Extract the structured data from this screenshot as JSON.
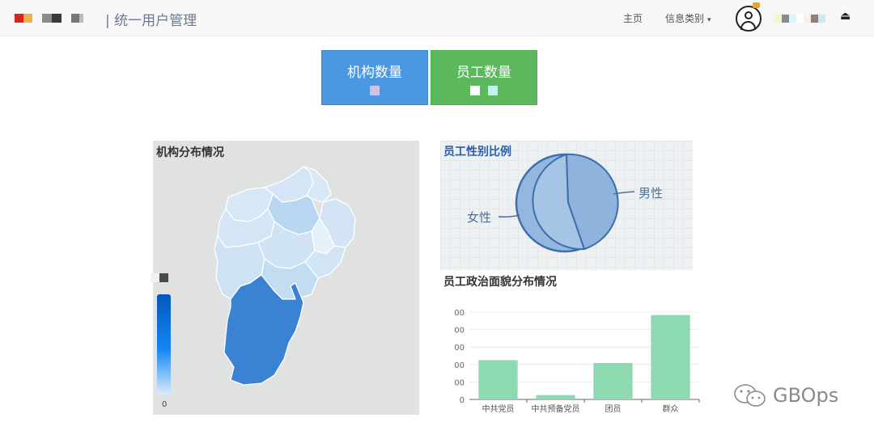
{
  "header": {
    "brand": "| 统一用户管理",
    "nav_home": "主页",
    "nav_info": "信息类别",
    "caret": "▾",
    "logout_icon": "⏏"
  },
  "cards": {
    "org_title": "机构数量",
    "emp_title": "员工数量"
  },
  "map": {
    "title": "机构分布情况",
    "legend_min": "0"
  },
  "gender": {
    "title": "员工性别比例",
    "male_label": "男性",
    "female_label": "女性"
  },
  "politics": {
    "title": "员工政治面貌分布情况"
  },
  "chart_data": {
    "type": "bar",
    "categories": [
      "中共党员",
      "中共预备党员",
      "团员",
      "群众"
    ],
    "values": [
      27,
      3,
      25,
      58
    ],
    "ylim": [
      0,
      60
    ],
    "yticks": [
      "00",
      "00",
      "00",
      "00",
      "00",
      "0"
    ],
    "bar_color": "#8dd9b0"
  },
  "watermark": {
    "text": "GBOps",
    "icon": "wechat-icon"
  },
  "colors": {
    "org_card": "#4a97e2",
    "emp_card": "#5cb85c",
    "map_highlight": "#3a82d4"
  }
}
